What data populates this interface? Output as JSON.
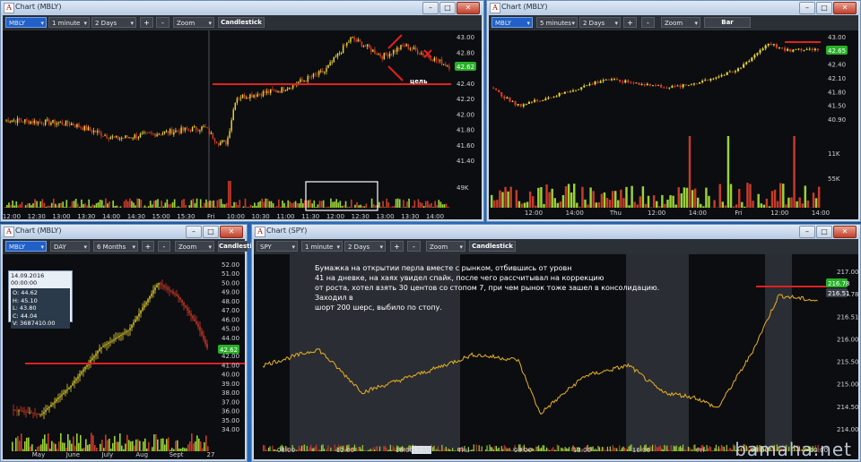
{
  "watermark": "bamaha.net",
  "win1": {
    "title": "Chart (MBLY)",
    "toolbar": {
      "symbol": "MBLY",
      "interval": "1 minute",
      "range": "2 Days",
      "plus": "+",
      "minus": "-",
      "zoom": "Zoom",
      "type": "Candlestick"
    },
    "yticks": [
      "43.00",
      "42.80",
      "42.60",
      "42.40",
      "42.20",
      "42.00",
      "41.80",
      "41.60",
      "41.40"
    ],
    "vol_tick": "49K",
    "last_price": "42.62",
    "xticks": [
      "12:00",
      "12:30",
      "13:00",
      "13:30",
      "14:00",
      "14:30",
      "15:00",
      "15:30",
      "Fri",
      "10:00",
      "10:30",
      "11:00",
      "11:30",
      "12:00",
      "12:30",
      "13:00",
      "13:30",
      "14:00"
    ],
    "annotation": "цель"
  },
  "win2": {
    "title": "Chart (MBLY)",
    "toolbar": {
      "symbol": "MBLY",
      "interval": "5 minutes",
      "range": "2 Days",
      "plus": "+",
      "minus": "-",
      "zoom": "Zoom",
      "type": "Bar"
    },
    "yticks": [
      "43.00",
      "42.65",
      "42.40",
      "42.10",
      "41.80",
      "41.50",
      "40.90"
    ],
    "vol_ticks": [
      "11K",
      "55K"
    ],
    "last_price": "42.65",
    "xticks": [
      "12:00",
      "14:00",
      "Thu",
      "12:00",
      "14:00",
      "Fri",
      "12:00",
      "14:00"
    ]
  },
  "win3": {
    "title": "Chart (MBLY)",
    "toolbar": {
      "symbol": "MBLY",
      "interval": "DAY",
      "range": "6 Months",
      "plus": "+",
      "minus": "-",
      "zoom": "Zoom",
      "type": "Candlestick"
    },
    "ohlc": {
      "date": "14.09.2016 00:00:00",
      "o": "O: 44.62",
      "h": "H: 45.10",
      "l": "L: 43.80",
      "c": "C: 44.04",
      "v": "V: 3687410.00"
    },
    "yticks": [
      "52.00",
      "51.00",
      "50.00",
      "49.00",
      "48.00",
      "47.00",
      "46.00",
      "45.00",
      "44.00",
      "43.00",
      "42.00",
      "41.00",
      "40.00",
      "39.00",
      "38.00",
      "37.00",
      "36.00",
      "35.00",
      "34.00"
    ],
    "last_price": "42.62",
    "xticks": [
      "May",
      "June",
      "July",
      "Aug",
      "Sept",
      "27"
    ]
  },
  "win4": {
    "title": "Chart (SPY)",
    "toolbar": {
      "symbol": "SPY",
      "interval": "1 minute",
      "range": "2 Days",
      "plus": "+",
      "minus": "-",
      "zoom": "Zoom",
      "type": "Candlestick"
    },
    "yticks": [
      "217.00",
      "216.78",
      "216.51",
      "216.00",
      "215.50",
      "215.00",
      "214.50",
      "214.00"
    ],
    "last_price": "216.78",
    "prev_price": "216.51",
    "xticks": [
      "08:00",
      "12:00",
      "16:00",
      "Thu",
      "08:00",
      "12:00",
      "16:00",
      "Fri",
      "08:00",
      "12:00"
    ],
    "time_box": "15:59"
  },
  "note": "Бумажка на открытии перла вместе с рынком, отбившись от уровн\n41 на дневке, на хаях увидел спайк, после чего рассчитывал на коррекцию\nот роста, хотел взять 30 центов со стопом 7, при чем рынок тоже зашел в консолидацию. Заходил в\nшорт 200 шерс, выбило по стопу.",
  "colors": {
    "up": "#e8d430",
    "down": "#d83a28",
    "line": "#e8b020",
    "level": "#e02020",
    "vol_up": "#9ad238",
    "vol_down": "#c83a2a",
    "price_tag": "#27b027"
  }
}
